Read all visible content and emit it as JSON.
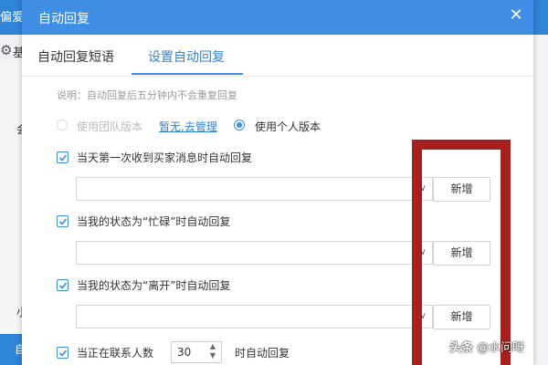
{
  "background": {
    "title_fragment": "偏爱",
    "word_fragment": "基",
    "side_fragment_1": "会",
    "side_fragment_2": "小",
    "tab_fragment": "自"
  },
  "dialog": {
    "title": "自动回复",
    "tabs": [
      {
        "label": "自动回复短语",
        "active": false
      },
      {
        "label": "设置自动回复",
        "active": true
      }
    ],
    "note": "说明：自动回复后五分钟内不会重复回复",
    "radio_team": "使用团队版本",
    "radio_team_link": "暂无,去管理",
    "radio_personal": "使用个人版本",
    "rules": [
      {
        "label": "当天第一次收到买家消息时自动回复",
        "checked": true,
        "select_value": "",
        "button": "新增"
      },
      {
        "label": "当我的状态为“忙碌”时自动回复",
        "checked": true,
        "select_value": "",
        "button": "新增"
      },
      {
        "label": "当我的状态为“离开”时自动回复",
        "checked": true,
        "select_value": "",
        "button": "新增"
      }
    ],
    "last_rule": {
      "label_prefix": "当正在联系人数",
      "count": "30",
      "label_suffix": "时自动回复",
      "checked": true
    }
  },
  "watermark": {
    "logo": "头条",
    "text": "@水问呀"
  },
  "colors": {
    "header": "#3f8de4",
    "accent": "#2f83d8",
    "annotation": "#a6201f"
  }
}
